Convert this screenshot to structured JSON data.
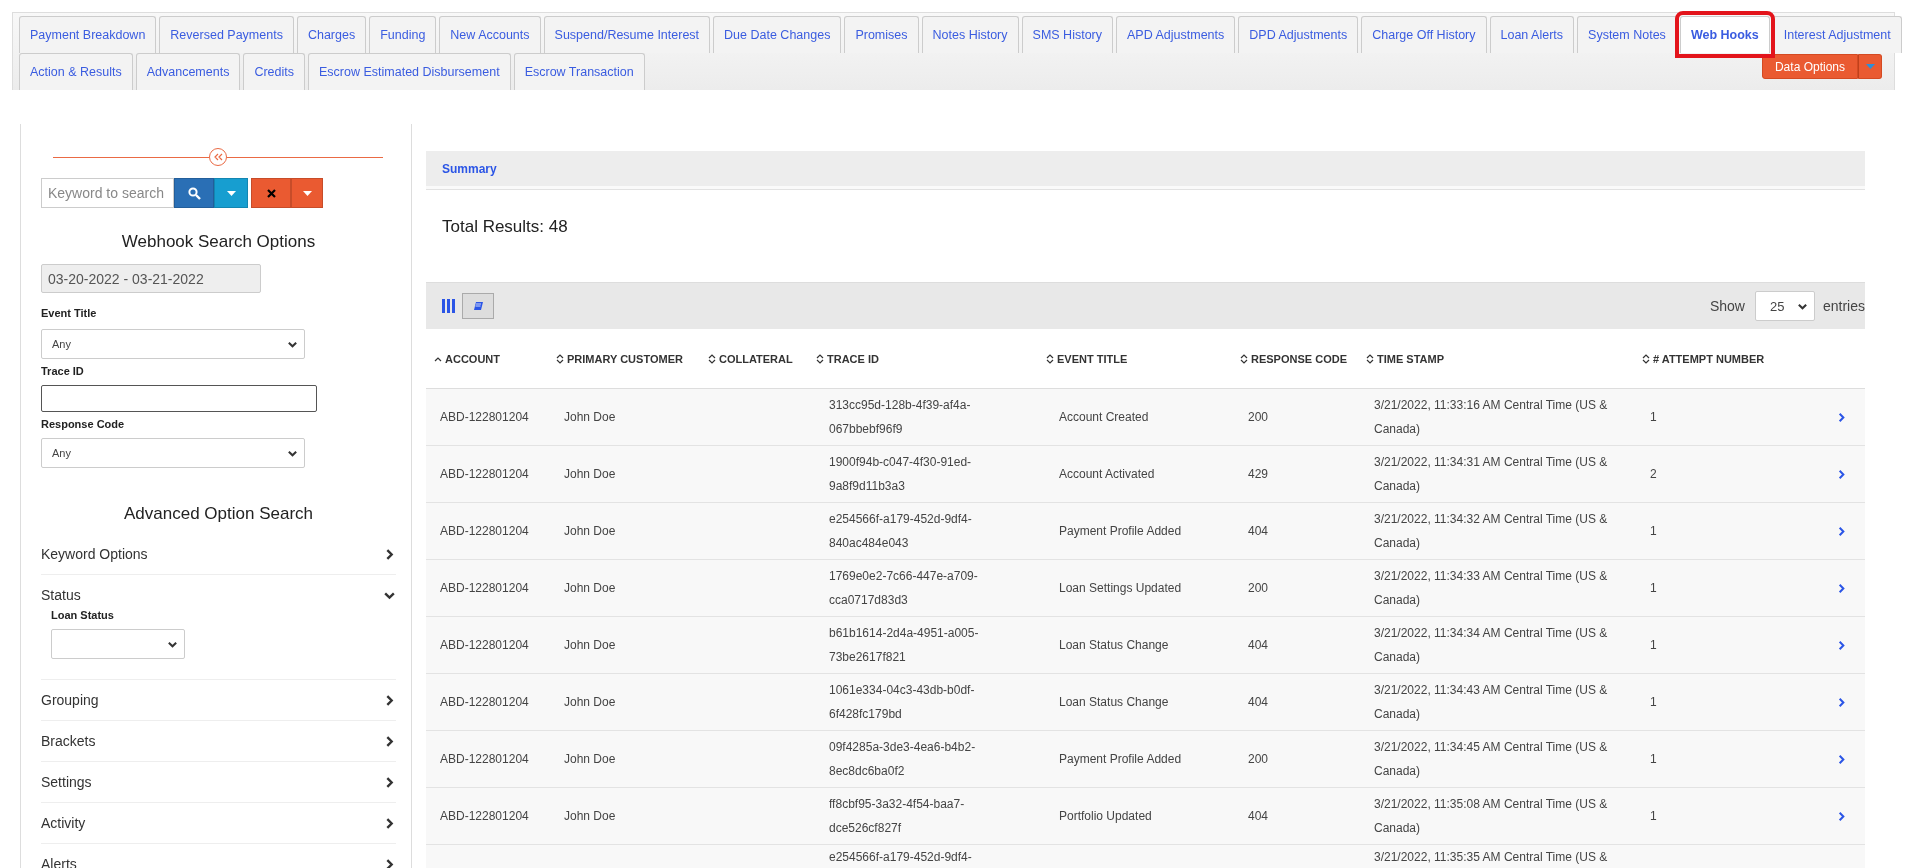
{
  "tabs": {
    "first_row": [
      {
        "label": "Payment Breakdown",
        "selected": false,
        "highlighted": false
      },
      {
        "label": "Reversed Payments",
        "selected": false,
        "highlighted": false
      },
      {
        "label": "Charges",
        "selected": false,
        "highlighted": false
      },
      {
        "label": "Funding",
        "selected": false,
        "highlighted": false
      },
      {
        "label": "New Accounts",
        "selected": false,
        "highlighted": false
      },
      {
        "label": "Suspend/Resume Interest",
        "selected": false,
        "highlighted": false
      },
      {
        "label": "Due Date Changes",
        "selected": false,
        "highlighted": false
      },
      {
        "label": "Promises",
        "selected": false,
        "highlighted": false
      },
      {
        "label": "Notes History",
        "selected": false,
        "highlighted": false
      },
      {
        "label": "SMS History",
        "selected": false,
        "highlighted": false
      },
      {
        "label": "APD Adjustments",
        "selected": false,
        "highlighted": false
      },
      {
        "label": "DPD Adjustments",
        "selected": false,
        "highlighted": false
      },
      {
        "label": "Charge Off History",
        "selected": false,
        "highlighted": false
      },
      {
        "label": "Loan Alerts",
        "selected": false,
        "highlighted": false
      },
      {
        "label": "System Notes",
        "selected": false,
        "highlighted": false
      },
      {
        "label": "Web Hooks",
        "selected": true,
        "highlighted": true
      },
      {
        "label": "Interest Adjustment",
        "selected": false,
        "highlighted": false
      }
    ],
    "second_row": [
      {
        "label": "Action & Results",
        "selected": false,
        "highlighted": false
      },
      {
        "label": "Advancements",
        "selected": false,
        "highlighted": false
      },
      {
        "label": "Credits",
        "selected": false,
        "highlighted": false
      },
      {
        "label": "Escrow Estimated Disbursement",
        "selected": false,
        "highlighted": false
      },
      {
        "label": "Escrow Transaction",
        "selected": false,
        "highlighted": false
      }
    ],
    "data_options": "Data Options"
  },
  "sidebar": {
    "search": {
      "placeholder": "Keyword to search"
    },
    "title": "Webhook Search Options",
    "date_range": "03-20-2022 - 03-21-2022",
    "fields": [
      {
        "kind": "select",
        "label": "Event Title",
        "value": "Any"
      },
      {
        "kind": "text",
        "label": "Trace ID"
      },
      {
        "kind": "select",
        "label": "Response Code",
        "value": "Any"
      }
    ],
    "advanced_title": "Advanced Option Search",
    "sections": [
      {
        "label": "Keyword Options",
        "expanded": false
      },
      {
        "label": "Status",
        "expanded": true,
        "fields": [
          {
            "kind": "select",
            "label": "Loan Status"
          }
        ]
      },
      {
        "label": "Grouping",
        "expanded": false
      },
      {
        "label": "Brackets",
        "expanded": false
      },
      {
        "label": "Settings",
        "expanded": false
      },
      {
        "label": "Activity",
        "expanded": false
      },
      {
        "label": "Alerts",
        "expanded": false
      }
    ]
  },
  "summary": "Summary",
  "total_results": "Total Results: 48",
  "table": {
    "show_label": "Show",
    "page_size": "25",
    "entries_label": "entries",
    "columns": [
      {
        "label": "ACCOUNT",
        "sorted": true
      },
      {
        "label": "PRIMARY CUSTOMER",
        "sorted": false
      },
      {
        "label": "COLLATERAL",
        "sorted": false
      },
      {
        "label": "TRACE ID",
        "sorted": false
      },
      {
        "label": "EVENT TITLE",
        "sorted": false
      },
      {
        "label": "RESPONSE CODE",
        "sorted": false
      },
      {
        "label": "TIME STAMP",
        "sorted": false
      },
      {
        "label": "# ATTEMPT NUMBER",
        "sorted": false
      }
    ],
    "rows": [
      {
        "account": "ABD-122801204",
        "customer": "John Doe",
        "trace_id": "313cc95d-128b-4f39-af4a-067bbebf96f9",
        "event": "Account Created",
        "code": "200",
        "timestamp": "3/21/2022, 11:33:16 AM Central Time (US & Canada)",
        "attempt": "1"
      },
      {
        "account": "ABD-122801204",
        "customer": "John Doe",
        "trace_id": "1900f94b-c047-4f30-91ed-9a8f9d11b3a3",
        "event": "Account Activated",
        "code": "429",
        "timestamp": "3/21/2022, 11:34:31 AM Central Time (US & Canada)",
        "attempt": "2"
      },
      {
        "account": "ABD-122801204",
        "customer": "John Doe",
        "trace_id": "e254566f-a179-452d-9df4-840ac484e043",
        "event": "Payment Profile Added",
        "code": "404",
        "timestamp": "3/21/2022, 11:34:32 AM Central Time (US & Canada)",
        "attempt": "1"
      },
      {
        "account": "ABD-122801204",
        "customer": "John Doe",
        "trace_id": "1769e0e2-7c66-447e-a709-cca0717d83d3",
        "event": "Loan Settings Updated",
        "code": "200",
        "timestamp": "3/21/2022, 11:34:33 AM Central Time (US & Canada)",
        "attempt": "1"
      },
      {
        "account": "ABD-122801204",
        "customer": "John Doe",
        "trace_id": "b61b1614-2d4a-4951-a005-73be2617f821",
        "event": "Loan Status Change",
        "code": "404",
        "timestamp": "3/21/2022, 11:34:34 AM Central Time (US & Canada)",
        "attempt": "1"
      },
      {
        "account": "ABD-122801204",
        "customer": "John Doe",
        "trace_id": "1061e334-04c3-43db-b0df-6f428fc179bd",
        "event": "Loan Status Change",
        "code": "404",
        "timestamp": "3/21/2022, 11:34:43 AM Central Time (US & Canada)",
        "attempt": "1"
      },
      {
        "account": "ABD-122801204",
        "customer": "John Doe",
        "trace_id": "09f4285a-3de3-4ea6-b4b2-8ec8dc6ba0f2",
        "event": "Payment Profile Added",
        "code": "200",
        "timestamp": "3/21/2022, 11:34:45 AM Central Time (US & Canada)",
        "attempt": "1"
      },
      {
        "account": "ABD-122801204",
        "customer": "John Doe",
        "trace_id": "ff8cbf95-3a32-4f54-baa7-dce526cf827f",
        "event": "Portfolio Updated",
        "code": "404",
        "timestamp": "3/21/2022, 11:35:08 AM Central Time (US & Canada)",
        "attempt": "1"
      },
      {
        "trace_id": "e254566f-a179-452d-9df4-",
        "timestamp": "3/21/2022, 11:35:35 AM Central Time (US &"
      }
    ]
  }
}
